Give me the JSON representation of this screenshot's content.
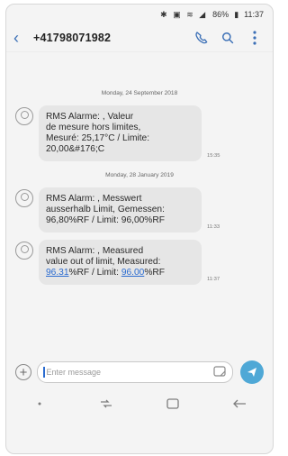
{
  "status": {
    "battery": "86%",
    "time": "11:37"
  },
  "header": {
    "contact": "+41798071982"
  },
  "thread": {
    "date1": "Monday, 24 September 2018",
    "date2": "Monday, 28 January 2019",
    "messages": [
      {
        "text": "RMS Alarme: , Valeur\nde mesure hors limites,\nMesuré: 25,17°C / Limite:\n20,00&#176;C",
        "time": "15:35"
      },
      {
        "text": "RMS Alarm: , Messwert\nausserhalb Limit, Gemessen:\n96,80%RF / Limit: 96,00%RF",
        "time": "11:33"
      },
      {
        "text_prefix": "RMS Alarm: , Measured\nvalue out of limit, Measured:\n",
        "measured": "96.31",
        "text_mid": "%RF / Limit: ",
        "limit": "96.00",
        "text_suffix": "%RF",
        "time": "11:37"
      }
    ]
  },
  "composer": {
    "placeholder": "Enter message"
  },
  "colors": {
    "accent": "#3b6fb6",
    "send": "#4fa8d6",
    "link": "#2a6bd0"
  }
}
